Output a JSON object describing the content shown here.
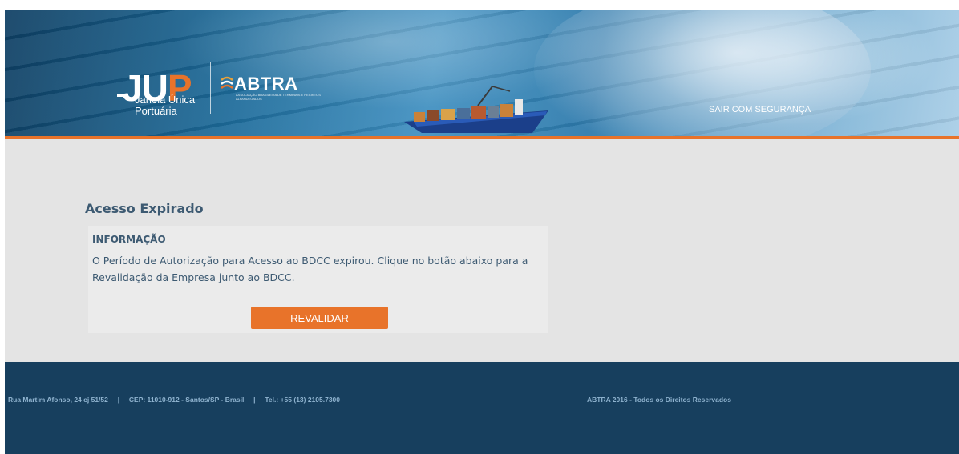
{
  "header": {
    "logo": {
      "jup_j": "J",
      "jup_u": "U",
      "jup_p": "P",
      "jup_sub_line1": "Janela Única",
      "jup_sub_line2": "Portuária"
    },
    "partner_logo": {
      "name": "ABTRA",
      "tagline": "ASSOCIAÇÃO BRASILEIRA DE TERMINAIS E RECINTOS ALFANDEGADOS"
    },
    "logout_label": "SAIR COM SEGURANÇA"
  },
  "main": {
    "title": "Acesso Expirado",
    "info_title": "INFORMAÇÃO",
    "info_text": "O Período de Autorização para Acesso ao BDCC expirou. Clique no botão abaixo para a Revalidação da Empresa junto ao BDCC.",
    "button_label": "REVALIDAR"
  },
  "footer": {
    "address": "Rua Martim Afonso, 24 cj 51/52",
    "separator": "|",
    "cep": "CEP: 11010-912 - Santos/SP - Brasil",
    "phone": "Tel.: +55 (13) 2105.7300",
    "copyright": "ABTRA 2016 - Todos os Direitos Reservados"
  },
  "colors": {
    "accent": "#e8732a",
    "text": "#3d5a72",
    "footer_bg": "#173f5e",
    "content_bg": "#e4e4e4"
  }
}
